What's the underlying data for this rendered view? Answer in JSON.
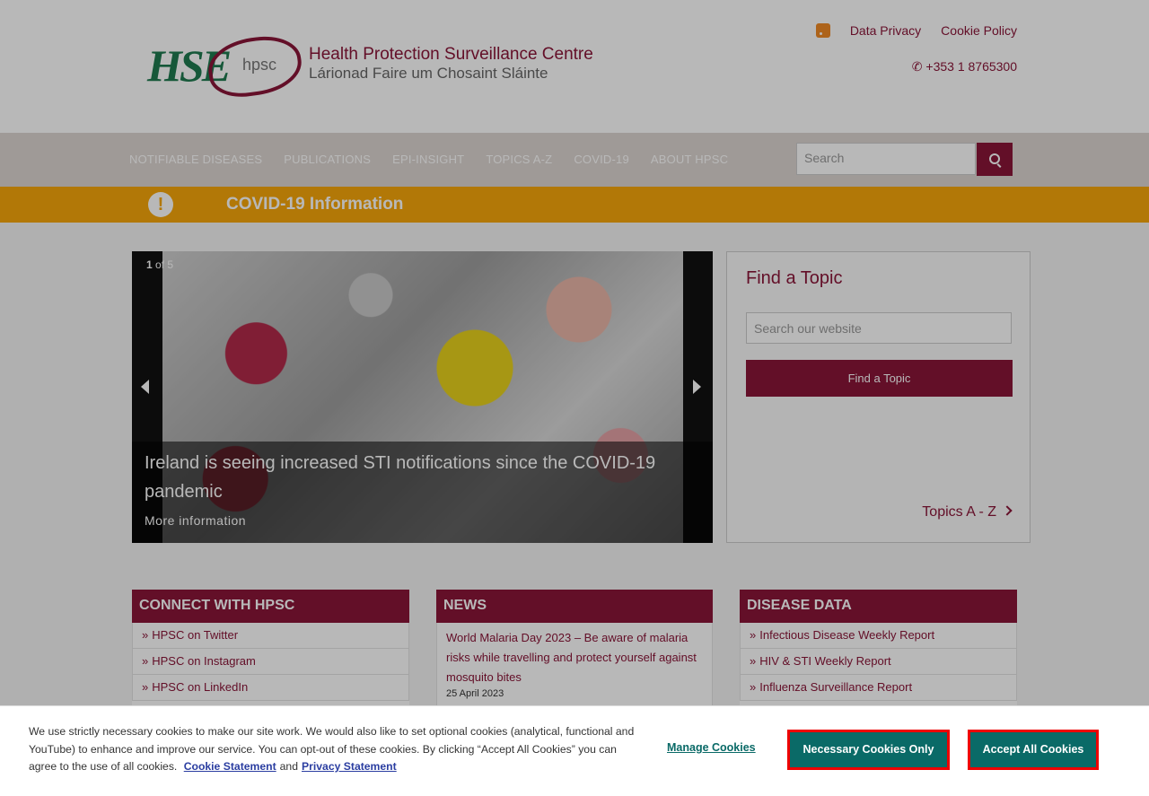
{
  "header": {
    "logo_title": "Health Protection Surveillance Centre",
    "logo_subtitle": "Lárionad Faire um Chosaint Sláinte",
    "logo_short": "hpsc",
    "logo_hse": "HSE",
    "links": [
      "Data Privacy",
      "Cookie Policy"
    ],
    "phone": "+353 1 8765300"
  },
  "nav": {
    "items": [
      "NOTIFIABLE DISEASES",
      "PUBLICATIONS",
      "EPI-INSIGHT",
      "TOPICS A-Z",
      "COVID-19",
      "ABOUT HPSC"
    ],
    "search_placeholder": "Search"
  },
  "covid_banner": {
    "title": "COVID-19 Information",
    "icon": "!"
  },
  "slider": {
    "current": "1",
    "of": "of",
    "total": "5",
    "caption": "Ireland is seeing increased STI notifications since the COVID-19 pandemic",
    "link": "More information"
  },
  "find_topic": {
    "title": "Find a Topic",
    "placeholder": "Search our website",
    "button": "Find a Topic",
    "az_link": "Topics A - Z"
  },
  "panels": {
    "connect": {
      "title": "CONNECT WITH HPSC",
      "items": [
        "HPSC on Twitter",
        "HPSC on Instagram",
        "HPSC on LinkedIn"
      ]
    },
    "news": {
      "title": "NEWS",
      "item_title": "World Malaria Day 2023 – Be aware of malaria risks while travelling and protect yourself against mosquito bites",
      "item_date": "25 April 2023"
    },
    "disease": {
      "title": "DISEASE DATA",
      "items": [
        "Infectious Disease Weekly Report",
        "HIV & STI Weekly Report",
        "Influenza Surveillance Report"
      ]
    },
    "bullet": "»"
  },
  "cookie": {
    "text": "We use strictly necessary cookies to make our site work. We would also like to set optional cookies (analytical, functional and YouTube) to enhance and improve our service. You can opt-out of these cookies. By clicking “Accept All Cookies” you can agree to the use of all cookies.",
    "statement_link": "Cookie Statement",
    "and": "and",
    "privacy_link": "Privacy Statement",
    "manage": "Manage Cookies",
    "necessary": "Necessary Cookies Only",
    "accept": "Accept All Cookies"
  },
  "colors": {
    "brand": "#8a1538",
    "banner": "#f7a70b",
    "cookie_button": "#0a6a67"
  }
}
